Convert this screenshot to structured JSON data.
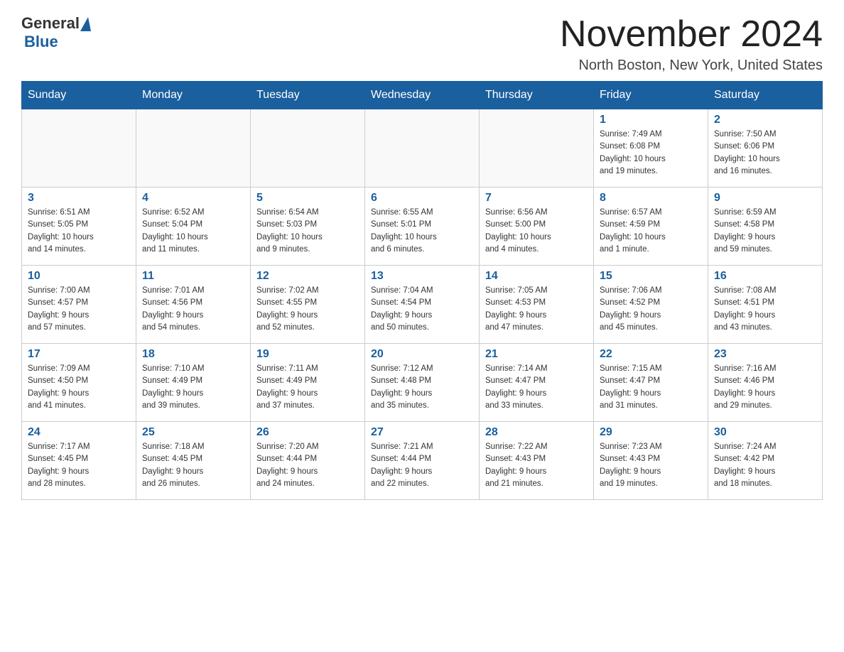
{
  "logo": {
    "general": "General",
    "blue": "Blue"
  },
  "title": "November 2024",
  "location": "North Boston, New York, United States",
  "weekdays": [
    "Sunday",
    "Monday",
    "Tuesday",
    "Wednesday",
    "Thursday",
    "Friday",
    "Saturday"
  ],
  "weeks": [
    [
      {
        "day": "",
        "info": ""
      },
      {
        "day": "",
        "info": ""
      },
      {
        "day": "",
        "info": ""
      },
      {
        "day": "",
        "info": ""
      },
      {
        "day": "",
        "info": ""
      },
      {
        "day": "1",
        "info": "Sunrise: 7:49 AM\nSunset: 6:08 PM\nDaylight: 10 hours\nand 19 minutes."
      },
      {
        "day": "2",
        "info": "Sunrise: 7:50 AM\nSunset: 6:06 PM\nDaylight: 10 hours\nand 16 minutes."
      }
    ],
    [
      {
        "day": "3",
        "info": "Sunrise: 6:51 AM\nSunset: 5:05 PM\nDaylight: 10 hours\nand 14 minutes."
      },
      {
        "day": "4",
        "info": "Sunrise: 6:52 AM\nSunset: 5:04 PM\nDaylight: 10 hours\nand 11 minutes."
      },
      {
        "day": "5",
        "info": "Sunrise: 6:54 AM\nSunset: 5:03 PM\nDaylight: 10 hours\nand 9 minutes."
      },
      {
        "day": "6",
        "info": "Sunrise: 6:55 AM\nSunset: 5:01 PM\nDaylight: 10 hours\nand 6 minutes."
      },
      {
        "day": "7",
        "info": "Sunrise: 6:56 AM\nSunset: 5:00 PM\nDaylight: 10 hours\nand 4 minutes."
      },
      {
        "day": "8",
        "info": "Sunrise: 6:57 AM\nSunset: 4:59 PM\nDaylight: 10 hours\nand 1 minute."
      },
      {
        "day": "9",
        "info": "Sunrise: 6:59 AM\nSunset: 4:58 PM\nDaylight: 9 hours\nand 59 minutes."
      }
    ],
    [
      {
        "day": "10",
        "info": "Sunrise: 7:00 AM\nSunset: 4:57 PM\nDaylight: 9 hours\nand 57 minutes."
      },
      {
        "day": "11",
        "info": "Sunrise: 7:01 AM\nSunset: 4:56 PM\nDaylight: 9 hours\nand 54 minutes."
      },
      {
        "day": "12",
        "info": "Sunrise: 7:02 AM\nSunset: 4:55 PM\nDaylight: 9 hours\nand 52 minutes."
      },
      {
        "day": "13",
        "info": "Sunrise: 7:04 AM\nSunset: 4:54 PM\nDaylight: 9 hours\nand 50 minutes."
      },
      {
        "day": "14",
        "info": "Sunrise: 7:05 AM\nSunset: 4:53 PM\nDaylight: 9 hours\nand 47 minutes."
      },
      {
        "day": "15",
        "info": "Sunrise: 7:06 AM\nSunset: 4:52 PM\nDaylight: 9 hours\nand 45 minutes."
      },
      {
        "day": "16",
        "info": "Sunrise: 7:08 AM\nSunset: 4:51 PM\nDaylight: 9 hours\nand 43 minutes."
      }
    ],
    [
      {
        "day": "17",
        "info": "Sunrise: 7:09 AM\nSunset: 4:50 PM\nDaylight: 9 hours\nand 41 minutes."
      },
      {
        "day": "18",
        "info": "Sunrise: 7:10 AM\nSunset: 4:49 PM\nDaylight: 9 hours\nand 39 minutes."
      },
      {
        "day": "19",
        "info": "Sunrise: 7:11 AM\nSunset: 4:49 PM\nDaylight: 9 hours\nand 37 minutes."
      },
      {
        "day": "20",
        "info": "Sunrise: 7:12 AM\nSunset: 4:48 PM\nDaylight: 9 hours\nand 35 minutes."
      },
      {
        "day": "21",
        "info": "Sunrise: 7:14 AM\nSunset: 4:47 PM\nDaylight: 9 hours\nand 33 minutes."
      },
      {
        "day": "22",
        "info": "Sunrise: 7:15 AM\nSunset: 4:47 PM\nDaylight: 9 hours\nand 31 minutes."
      },
      {
        "day": "23",
        "info": "Sunrise: 7:16 AM\nSunset: 4:46 PM\nDaylight: 9 hours\nand 29 minutes."
      }
    ],
    [
      {
        "day": "24",
        "info": "Sunrise: 7:17 AM\nSunset: 4:45 PM\nDaylight: 9 hours\nand 28 minutes."
      },
      {
        "day": "25",
        "info": "Sunrise: 7:18 AM\nSunset: 4:45 PM\nDaylight: 9 hours\nand 26 minutes."
      },
      {
        "day": "26",
        "info": "Sunrise: 7:20 AM\nSunset: 4:44 PM\nDaylight: 9 hours\nand 24 minutes."
      },
      {
        "day": "27",
        "info": "Sunrise: 7:21 AM\nSunset: 4:44 PM\nDaylight: 9 hours\nand 22 minutes."
      },
      {
        "day": "28",
        "info": "Sunrise: 7:22 AM\nSunset: 4:43 PM\nDaylight: 9 hours\nand 21 minutes."
      },
      {
        "day": "29",
        "info": "Sunrise: 7:23 AM\nSunset: 4:43 PM\nDaylight: 9 hours\nand 19 minutes."
      },
      {
        "day": "30",
        "info": "Sunrise: 7:24 AM\nSunset: 4:42 PM\nDaylight: 9 hours\nand 18 minutes."
      }
    ]
  ]
}
